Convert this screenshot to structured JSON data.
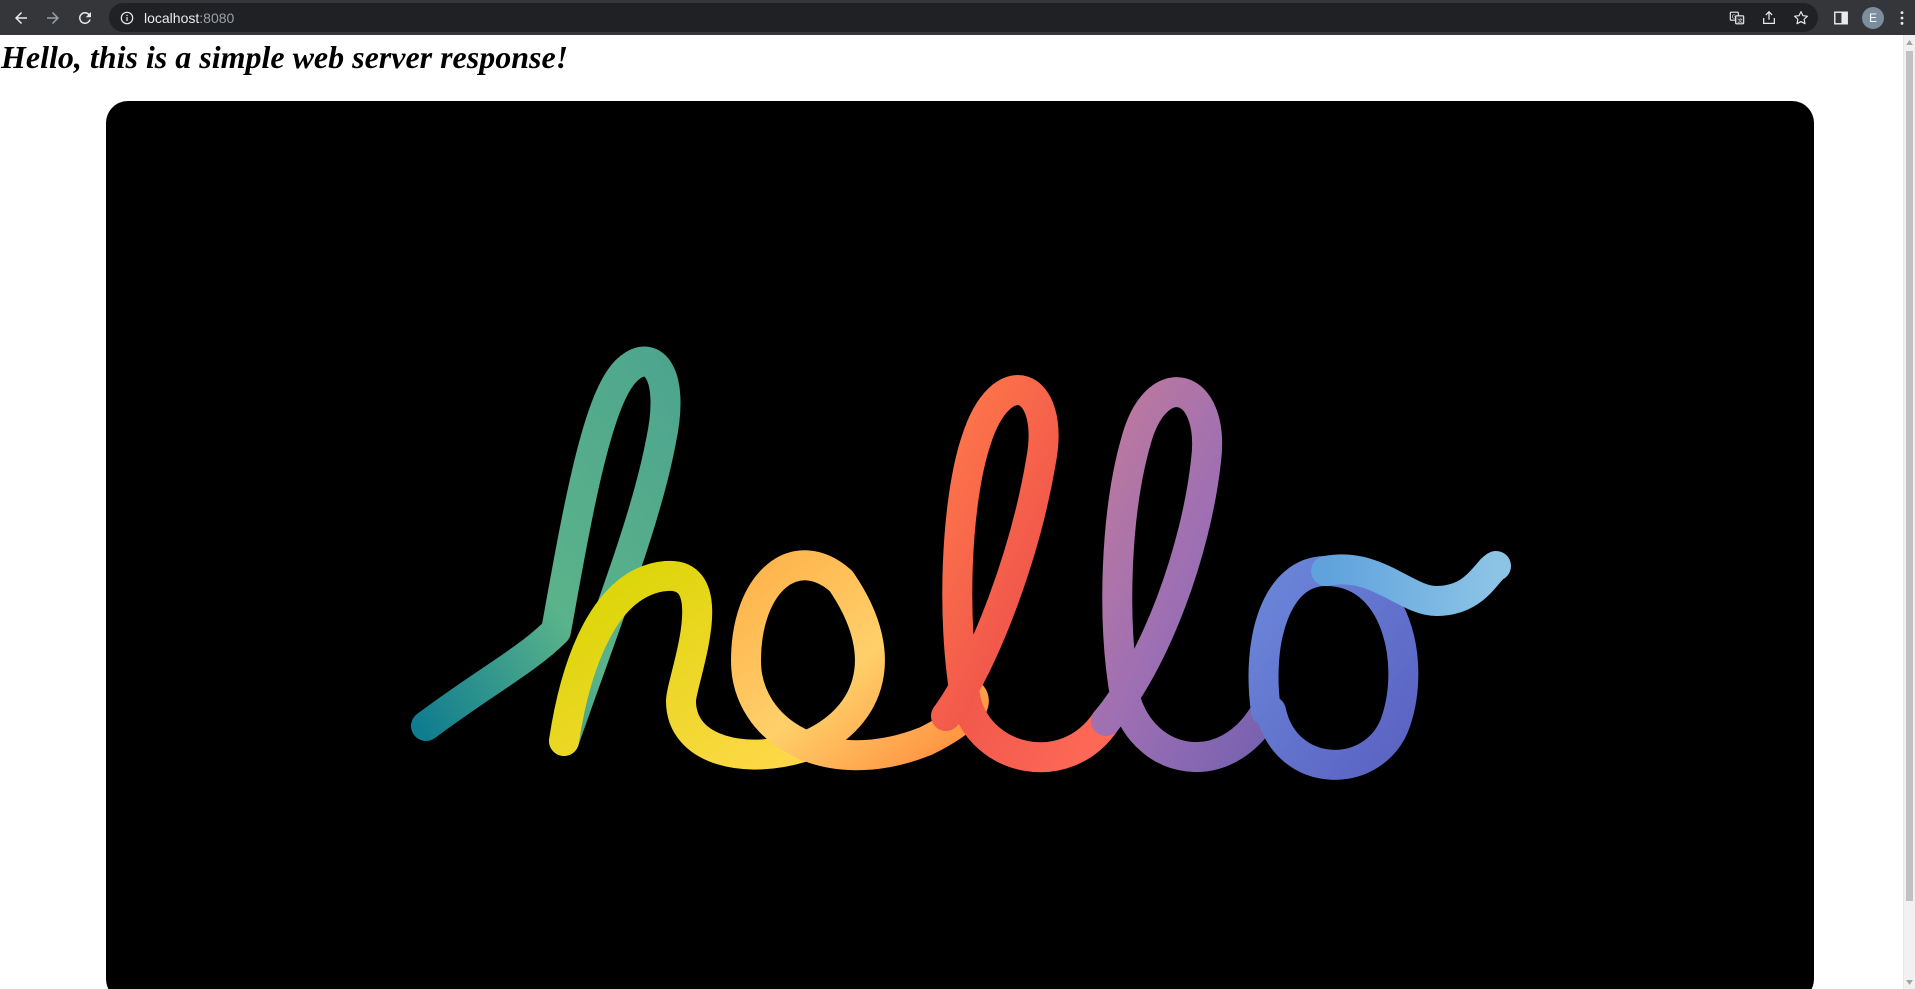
{
  "browser": {
    "url_host": "localhost",
    "url_port": ":8080",
    "avatar_letter": "E",
    "icons": {
      "back": "arrow-left-icon",
      "forward": "arrow-right-icon",
      "reload": "reload-icon",
      "site_info": "info-icon",
      "translate": "translate-icon",
      "share": "share-icon",
      "bookmark": "star-icon",
      "side_panel": "side-panel-icon",
      "menu": "kebab-menu-icon"
    },
    "colors": {
      "toolbar": "#35363a",
      "omnibox": "#202124",
      "url_text": "#e8eaed",
      "port_text": "#9aa0a6"
    }
  },
  "page": {
    "heading": "Hello, this is a simple web server response!",
    "image": {
      "background": "#000000",
      "gradient_colors": [
        "#0f7c8f",
        "#5ab38a",
        "#d8d600",
        "#ffd84a",
        "#ff9a3c",
        "#f2594b",
        "#9d6fb3",
        "#6a86d9",
        "#7ab3e0"
      ]
    }
  }
}
